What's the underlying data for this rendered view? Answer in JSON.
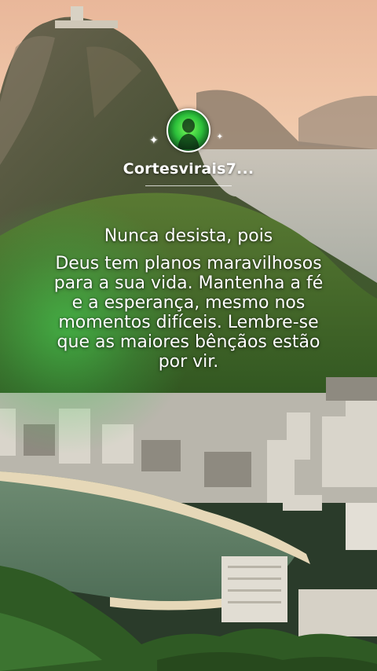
{
  "profile": {
    "username": "Cortesvirais7...",
    "avatar_icon": "green-avatar-icon",
    "sparkle_icon": "sparkle-icon"
  },
  "quote": {
    "line1": "Nunca desista, pois",
    "body": "Deus tem planos maravilhosos para a sua vida. Mantenha a fé e a esperança, mesmo nos momentos difíceis. Lembre-se que as maiores bênçãos estão por vir."
  },
  "colors": {
    "sky_top": "#f4c9a8",
    "mountain": "#3a4a2e",
    "vegetation": "#3d6b2a",
    "glow": "#46e65a",
    "text": "#ffffff"
  }
}
